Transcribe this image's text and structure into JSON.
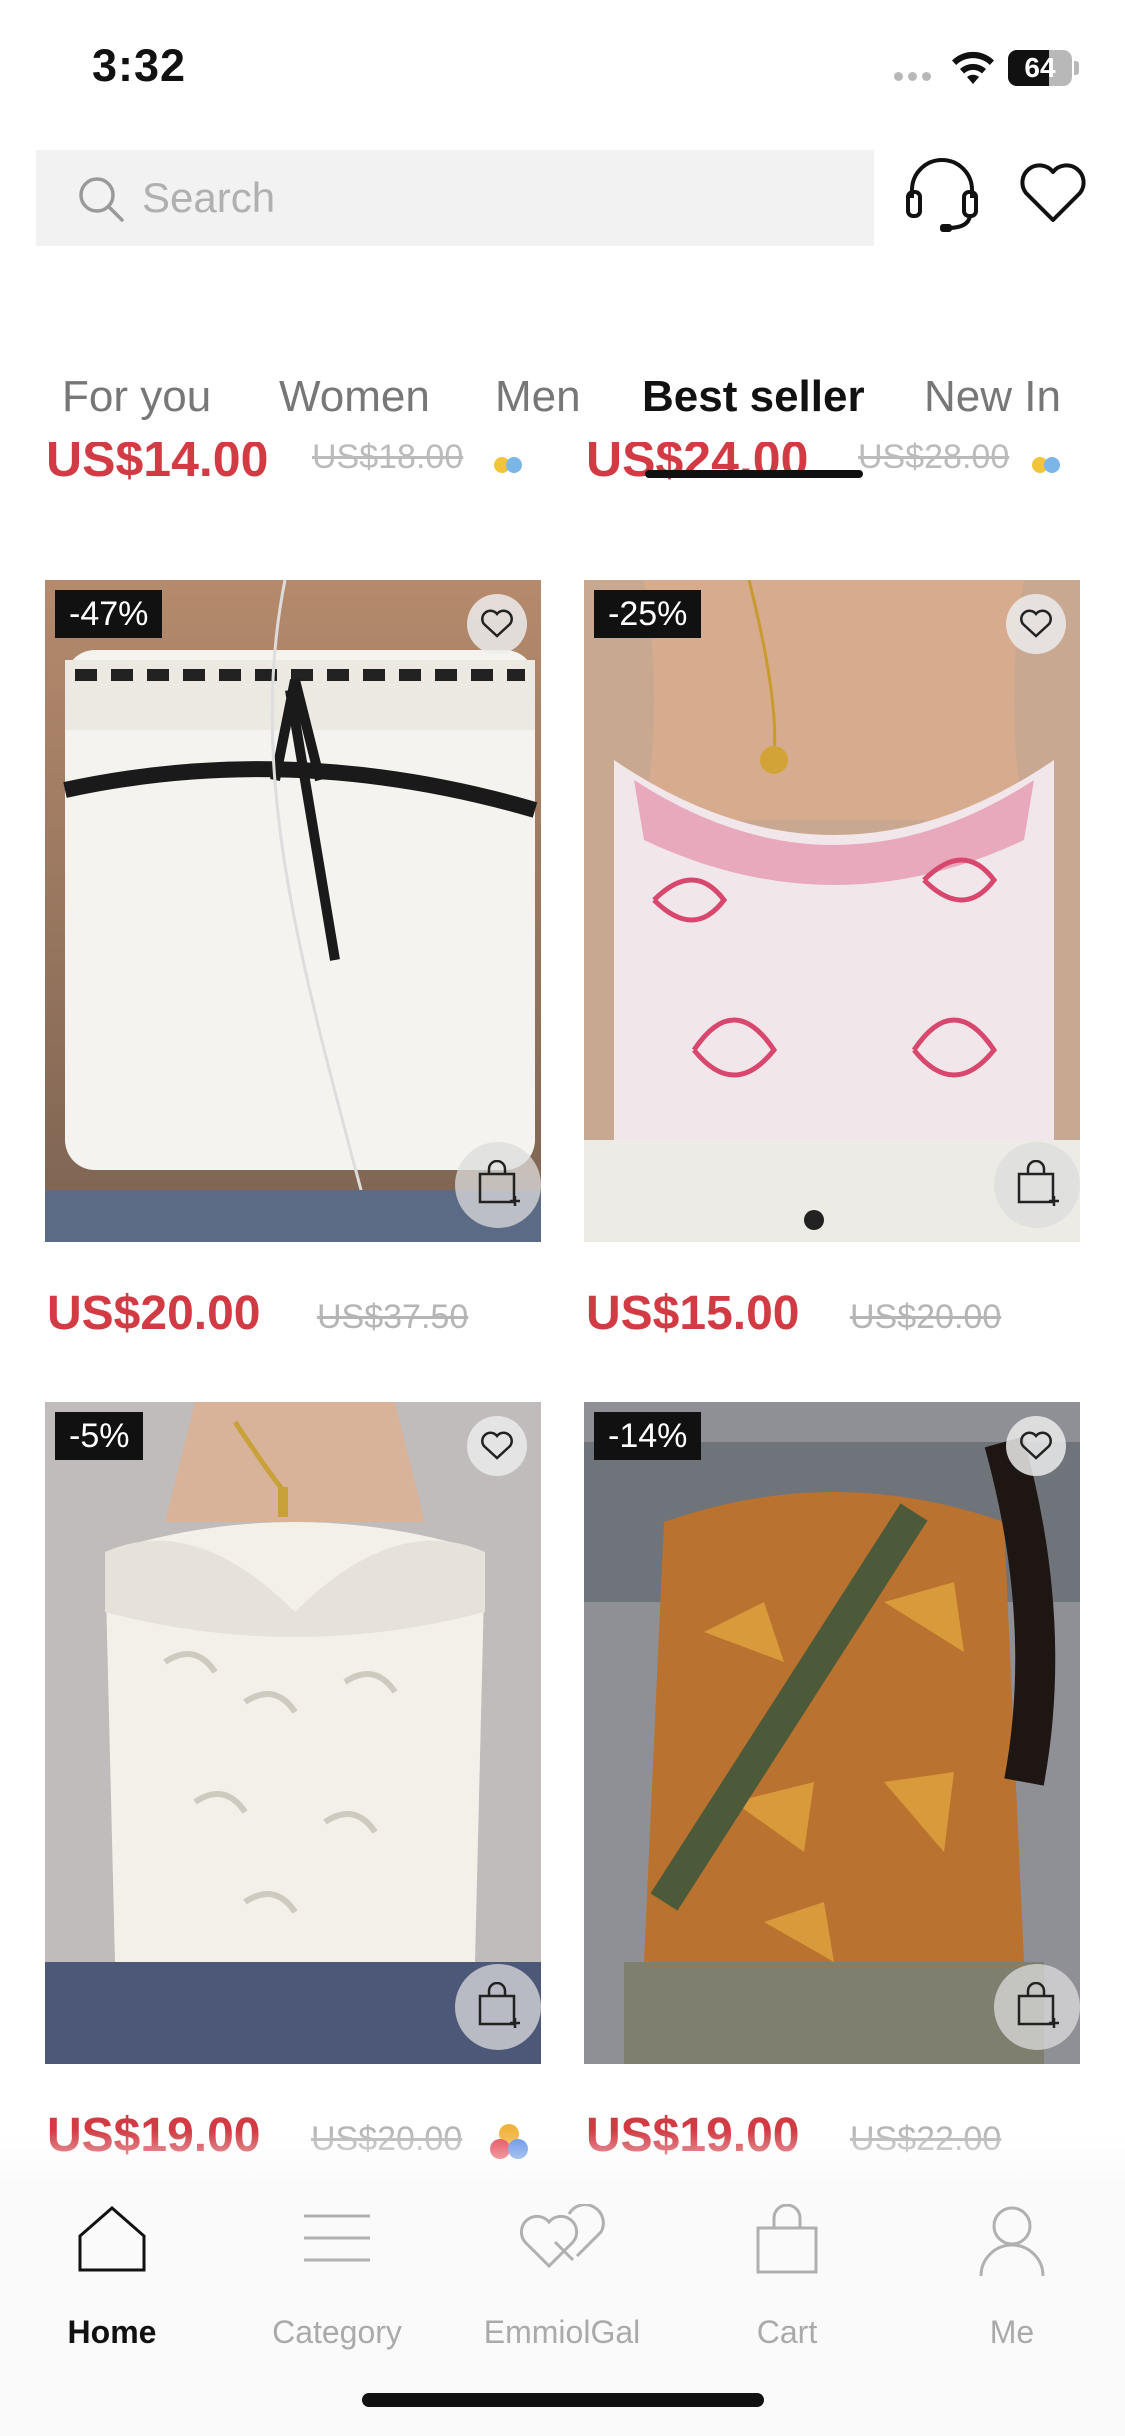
{
  "status_bar": {
    "time": "3:32",
    "battery": "64",
    "battery_level": 0.64
  },
  "header": {
    "search_placeholder": "Search",
    "support_icon": "headset-icon",
    "wishlist_icon": "heart-icon"
  },
  "tabs": [
    {
      "label": "For you",
      "active": false
    },
    {
      "label": "Women",
      "active": false
    },
    {
      "label": "Men",
      "active": false
    },
    {
      "label": "Best seller",
      "active": true
    },
    {
      "label": "New In",
      "active": false
    }
  ],
  "partial_row": [
    {
      "price": "US$14.00",
      "old_price": "US$18.00"
    },
    {
      "price": "US$24.00",
      "old_price": "US$28.00"
    }
  ],
  "products": [
    {
      "discount": "-47%",
      "price": "US$20.00",
      "old_price": "US$37.50",
      "has_colors": false,
      "image": "white-eyelet-tube-top-with-black-ribbon"
    },
    {
      "discount": "-25%",
      "price": "US$15.00",
      "old_price": "US$20.00",
      "has_colors": false,
      "image": "pink-floral-mesh-cami-top"
    },
    {
      "discount": "-5%",
      "price": "US$19.00",
      "old_price": "US$20.00",
      "has_colors": true,
      "image": "white-lace-halter-top"
    },
    {
      "discount": "-14%",
      "price": "US$19.00",
      "old_price": "US$22.00",
      "has_colors": false,
      "image": "butterfly-print-mesh-halter-top"
    }
  ],
  "bottom_nav": [
    {
      "label": "Home",
      "icon": "home-icon",
      "active": true
    },
    {
      "label": "Category",
      "icon": "category-icon",
      "active": false
    },
    {
      "label": "EmmiolGal",
      "icon": "double-heart-icon",
      "active": false
    },
    {
      "label": "Cart",
      "icon": "shopping-bag-icon",
      "active": false
    },
    {
      "label": "Me",
      "icon": "profile-icon",
      "active": false
    }
  ],
  "colors": {
    "price_red": "#d23b44",
    "text_dark": "#111111",
    "text_gray": "#777777",
    "badge_black": "#111111"
  }
}
